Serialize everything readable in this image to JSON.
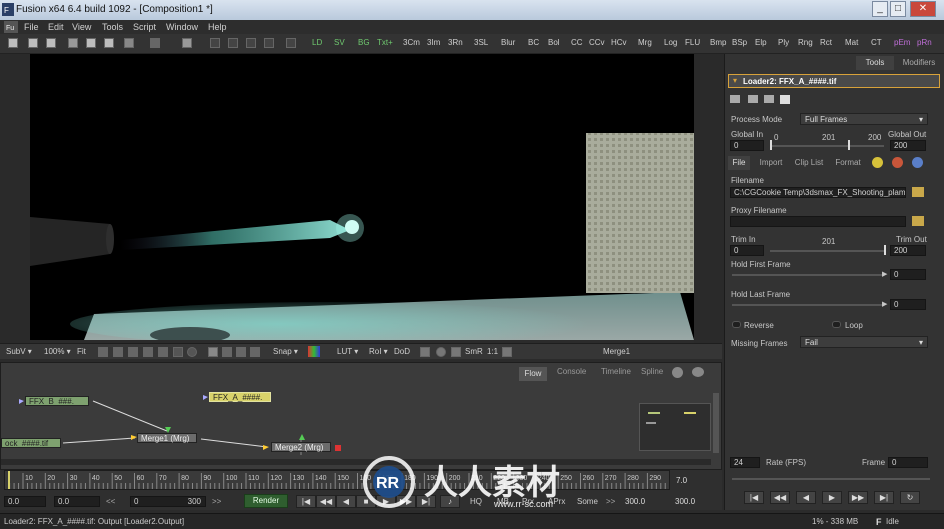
{
  "window": {
    "title": "Fusion x64 6.4 build 1092 - [Composition1 *]",
    "app_icon": "fusion-logo",
    "controls": [
      "_",
      "□",
      "✕"
    ]
  },
  "menu": [
    "File",
    "Edit",
    "View",
    "Tools",
    "Script",
    "Window",
    "Help"
  ],
  "toolbar": {
    "tools": [
      "LD",
      "SV",
      "BG",
      "Txt+",
      "3Cm",
      "3Im",
      "3Rn",
      "3SL",
      "Blur",
      "BC",
      "Bol",
      "CC",
      "CCv",
      "HCv",
      "Mrg",
      "Log",
      "FLU",
      "Bmp",
      "BSp",
      "Elp",
      "Ply",
      "Rng",
      "Rct",
      "Mat",
      "CT",
      "pEm",
      "pRn"
    ],
    "colors": {
      "green": "#6fc96f",
      "purple": "#c06fd8",
      "default": "#cfcfcf"
    }
  },
  "viewer": {
    "toolbar": {
      "subv": "SubV ▾",
      "zoom": "100% ▾",
      "fit": "Fit",
      "snap": "Snap ▾",
      "lut": "LUT ▾",
      "roi": "RoI ▾",
      "dod": "DoD",
      "smr": "SmR",
      "ratio": "1:1",
      "view_name": "Merge1"
    }
  },
  "flow": {
    "tabs": [
      "Flow",
      "Console",
      "Timeline",
      "Spline"
    ],
    "active_tab": "Flow",
    "nodes": {
      "ffx_b": "FFX_B_###.",
      "ffx_a": "FFX_A_####.",
      "back": "ock_####.tif",
      "merge1": "Merge1 (Mrg)",
      "merge2": "Merge2 (Mrg)"
    }
  },
  "timeline": {
    "ticks": [
      "10",
      "20",
      "30",
      "40",
      "50",
      "60",
      "70",
      "80",
      "90",
      "100",
      "110",
      "120",
      "130",
      "140",
      "150",
      "160",
      "170",
      "180",
      "190",
      "200",
      "210",
      "220",
      "230",
      "240",
      "250",
      "260",
      "270",
      "280",
      "290"
    ],
    "end_value": "7.0",
    "current_time": "0.0",
    "render_start": "0.0",
    "global_start": "0",
    "global_end": "300",
    "render_label": "Render",
    "hq": "HQ",
    "mb": "MB",
    "prx": "Prx",
    "aprx": "APrx",
    "some": "Some",
    "end1": "300.0",
    "end2": "300.0"
  },
  "status": {
    "left": "Loader2: FFX_A_####.tif: Output   [Loader2.Output]",
    "memory": "1% - 338 MB",
    "state": "Idle"
  },
  "panel": {
    "tabs": [
      "Tools",
      "Modifiers"
    ],
    "active_tab": "Tools",
    "tool_header": "Loader2: FFX_A_####.tif",
    "process_mode_label": "Process Mode",
    "process_mode_value": "Full Frames",
    "global_in_label": "Global In",
    "global_out_label": "Global Out",
    "global_in_value": "0",
    "global_out_value": "200",
    "global_min": "0",
    "global_mid": "201",
    "global_max": "200",
    "subtabs": [
      "File",
      "Import",
      "Clip List",
      "Format"
    ],
    "filename_label": "Filename",
    "filename_value": "C:\\CGCookie Temp\\3dsmax_FX_Shooting_plama_",
    "proxy_label": "Proxy Filename",
    "trim_in_label": "Trim In",
    "trim_out_label": "Trim Out",
    "trim_in_value": "0",
    "trim_mid": "201",
    "trim_out_value": "200",
    "hold_first_label": "Hold First Frame",
    "hold_first_value": "0",
    "hold_last_label": "Hold Last Frame",
    "hold_last_value": "0",
    "reverse_label": "Reverse",
    "loop_label": "Loop",
    "missing_frames_label": "Missing Frames",
    "missing_frames_value": "Fail",
    "fps_value": "24",
    "fps_label": "Rate (FPS)",
    "frame_label": "Frame",
    "frame_value": "0"
  },
  "watermark": {
    "text": "人人素材",
    "url": "www.rr-sc.com"
  }
}
